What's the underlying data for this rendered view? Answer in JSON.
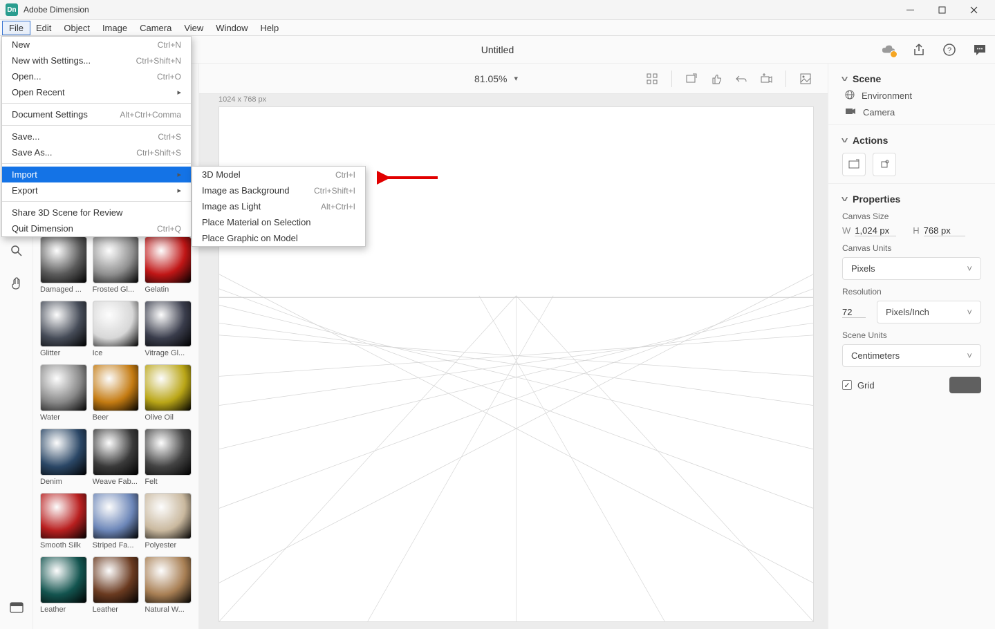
{
  "app": {
    "name": "Adobe Dimension"
  },
  "menubar": [
    "File",
    "Edit",
    "Object",
    "Image",
    "Camera",
    "View",
    "Window",
    "Help"
  ],
  "file_menu": [
    {
      "label": "New",
      "shortcut": "Ctrl+N"
    },
    {
      "label": "New with Settings...",
      "shortcut": "Ctrl+Shift+N"
    },
    {
      "label": "Open...",
      "shortcut": "Ctrl+O"
    },
    {
      "label": "Open Recent",
      "shortcut": "",
      "submenu": true
    },
    {
      "sep": true
    },
    {
      "label": "Document Settings",
      "shortcut": "Alt+Ctrl+Comma"
    },
    {
      "sep": true
    },
    {
      "label": "Save...",
      "shortcut": "Ctrl+S"
    },
    {
      "label": "Save As...",
      "shortcut": "Ctrl+Shift+S"
    },
    {
      "sep": true
    },
    {
      "label": "Import",
      "shortcut": "",
      "submenu": true,
      "highlight": true
    },
    {
      "label": "Export",
      "shortcut": "",
      "submenu": true
    },
    {
      "sep": true
    },
    {
      "label": "Share 3D Scene for Review"
    },
    {
      "label": "Quit Dimension",
      "shortcut": "Ctrl+Q"
    }
  ],
  "import_submenu": [
    {
      "label": "3D Model",
      "shortcut": "Ctrl+I"
    },
    {
      "label": "Image as Background",
      "shortcut": "Ctrl+Shift+I"
    },
    {
      "label": "Image as Light",
      "shortcut": "Alt+Ctrl+I"
    },
    {
      "label": "Place Material on Selection"
    },
    {
      "label": "Place Graphic on Model"
    }
  ],
  "document": {
    "title": "Untitled",
    "zoom": "81.05%",
    "canvas_dims": "1024 x 768 px"
  },
  "assets": [
    {
      "label": "Damaged ...",
      "bg": "#5a5a5a"
    },
    {
      "label": "Frosted Gl...",
      "bg": "#8f8f8f"
    },
    {
      "label": "Gelatin",
      "bg": "#c01616"
    },
    {
      "label": "Glitter",
      "bg": "#464c58"
    },
    {
      "label": "Ice",
      "bg": "#d7d7d7"
    },
    {
      "label": "Vitrage Gl...",
      "bg": "#3a3d4c"
    },
    {
      "label": "Water",
      "bg": "#888"
    },
    {
      "label": "Beer",
      "bg": "#c47b12"
    },
    {
      "label": "Olive Oil",
      "bg": "#baa617"
    },
    {
      "label": "Denim",
      "bg": "#2b4766"
    },
    {
      "label": "Weave Fab...",
      "bg": "#3a3a3a"
    },
    {
      "label": "Felt",
      "bg": "#444"
    },
    {
      "label": "Smooth Silk",
      "bg": "#b81f1f"
    },
    {
      "label": "Striped Fa...",
      "bg": "#6c86b8"
    },
    {
      "label": "Polyester",
      "bg": "#c9b89e"
    },
    {
      "label": "Leather",
      "bg": "#13544f"
    },
    {
      "label": "Leather",
      "bg": "#6a3a20"
    },
    {
      "label": "Natural W...",
      "bg": "#a87f54"
    }
  ],
  "scene": {
    "title": "Scene",
    "items": [
      {
        "icon": "globe",
        "label": "Environment"
      },
      {
        "icon": "camera",
        "label": "Camera"
      }
    ]
  },
  "actions": {
    "title": "Actions"
  },
  "properties": {
    "title": "Properties",
    "canvas_size_label": "Canvas Size",
    "w_label": "W",
    "w_value": "1,024 px",
    "h_label": "H",
    "h_value": "768 px",
    "canvas_units_label": "Canvas Units",
    "canvas_units_value": "Pixels",
    "resolution_label": "Resolution",
    "resolution_value": "72",
    "resolution_units": "Pixels/Inch",
    "scene_units_label": "Scene Units",
    "scene_units_value": "Centimeters",
    "grid_label": "Grid",
    "grid_checked": true
  }
}
